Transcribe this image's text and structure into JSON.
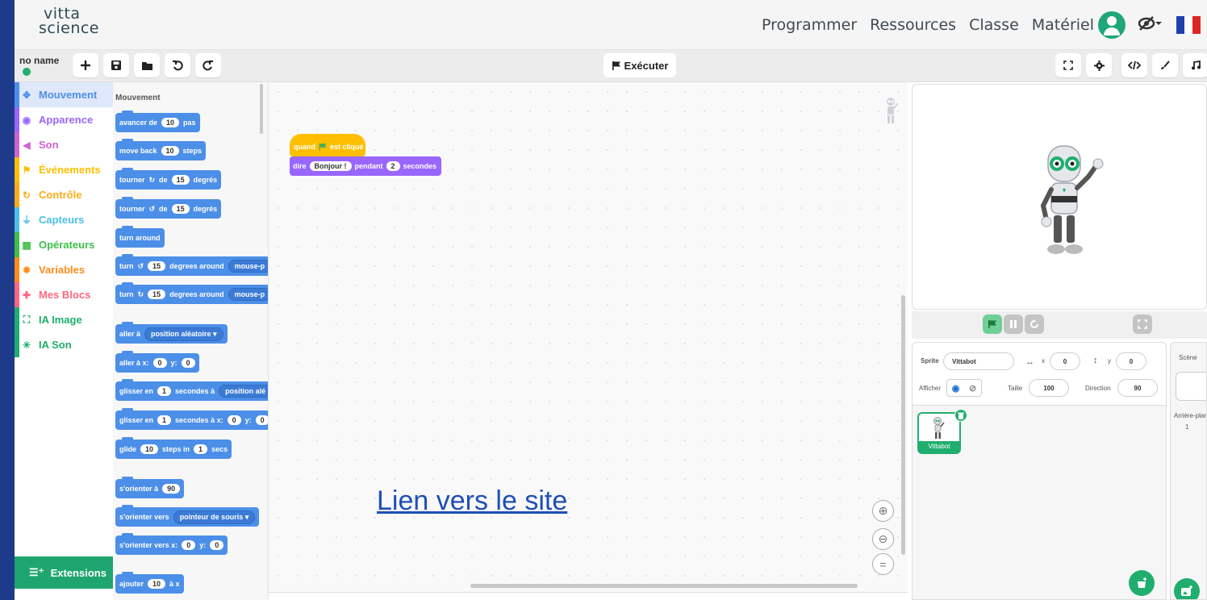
{
  "header": {
    "logo_line1": "vitta",
    "logo_line2": "science",
    "nav": [
      "Programmer",
      "Ressources",
      "Classe",
      "Matériel"
    ],
    "accent_color": "#1fa67a"
  },
  "toolbar": {
    "project_name": "no name",
    "new_icon": "plus-icon",
    "save_icon": "floppy-icon",
    "open_icon": "folder-icon",
    "undo_icon": "undo-icon",
    "redo_icon": "redo-icon",
    "run_label": "Exécuter",
    "right_icons": [
      "fullscreen-icon",
      "gear-icon",
      "code-icon",
      "brush-icon",
      "music-icon"
    ]
  },
  "categories": [
    {
      "label": "Mouvement",
      "color": "#4c8fe8",
      "icon": "move-icon",
      "selected": true
    },
    {
      "label": "Apparence",
      "color": "#9966ff",
      "icon": "eye-icon"
    },
    {
      "label": "Son",
      "color": "#cf63cf",
      "icon": "speaker-icon"
    },
    {
      "label": "Événements",
      "color": "#ffbf00",
      "icon": "flag-icon"
    },
    {
      "label": "Contrôle",
      "color": "#ffab19",
      "icon": "loop-icon"
    },
    {
      "label": "Capteurs",
      "color": "#4cbfe6",
      "icon": "plug-icon"
    },
    {
      "label": "Opérateurs",
      "color": "#40bf4a",
      "icon": "calculator-icon"
    },
    {
      "label": "Variables",
      "color": "#ff8c1a",
      "icon": "gear-icon"
    },
    {
      "label": "Mes Blocs",
      "color": "#ff6680",
      "icon": "puzzle-icon"
    },
    {
      "label": "IA Image",
      "color": "#1fae6e",
      "icon": "frame-icon"
    },
    {
      "label": "IA Son",
      "color": "#1fae6e",
      "icon": "sparkle-icon"
    }
  ],
  "extensions_label": "Extensions",
  "palette": {
    "title": "Mouvement",
    "blocks": {
      "b1": [
        "avancer de",
        "10",
        "pas"
      ],
      "b2": [
        "move back",
        "10",
        "steps"
      ],
      "b3": [
        "tourner",
        "de",
        "15",
        "degrés"
      ],
      "b4": [
        "tourner",
        "de",
        "15",
        "degrés"
      ],
      "b5": [
        "turn around"
      ],
      "b6": [
        "turn",
        "15",
        "degrees around",
        "mouse-p"
      ],
      "b7": [
        "turn",
        "15",
        "degrees around",
        "mouse-p"
      ],
      "b8": [
        "aller à",
        "position aléatoire ▾"
      ],
      "b9": [
        "aller à x:",
        "0",
        "y:",
        "0"
      ],
      "b10": [
        "glisser en",
        "1",
        "secondes à",
        "position alé"
      ],
      "b11": [
        "glisser en",
        "1",
        "secondes à x:",
        "0",
        "y:",
        "0"
      ],
      "b12": [
        "glide",
        "10",
        "steps in",
        "1",
        "secs"
      ],
      "b13": [
        "s'orienter à",
        "90"
      ],
      "b14": [
        "s'orienter vers",
        "pointeur de souris ▾"
      ],
      "b15": [
        "s'orienter vers x:",
        "0",
        "y:",
        "0"
      ],
      "b16": [
        "ajouter",
        "10",
        "à x"
      ]
    }
  },
  "workspace": {
    "hat_label_pre": "quand",
    "hat_label_post": "est cliqué",
    "say_pre": "dire",
    "say_text": "Bonjour !",
    "say_mid": "pendant",
    "say_secs": "2",
    "say_post": "secondes",
    "link_text": "Lien vers le site",
    "zoom_in": "⊕",
    "zoom_out": "⊖",
    "zoom_reset": "="
  },
  "sprite": {
    "sprite_label": "Sprite",
    "name": "Vittabot",
    "x_label": "x",
    "x": "0",
    "y_label": "y",
    "y": "0",
    "show_label": "Afficher",
    "size_label": "Taille",
    "size": "100",
    "direction_label": "Direction",
    "direction": "90",
    "thumb_name": "Vittabot"
  },
  "scene": {
    "label": "Scène",
    "backdrops_label": "Arrière-plans",
    "backdrops_count": "1"
  }
}
